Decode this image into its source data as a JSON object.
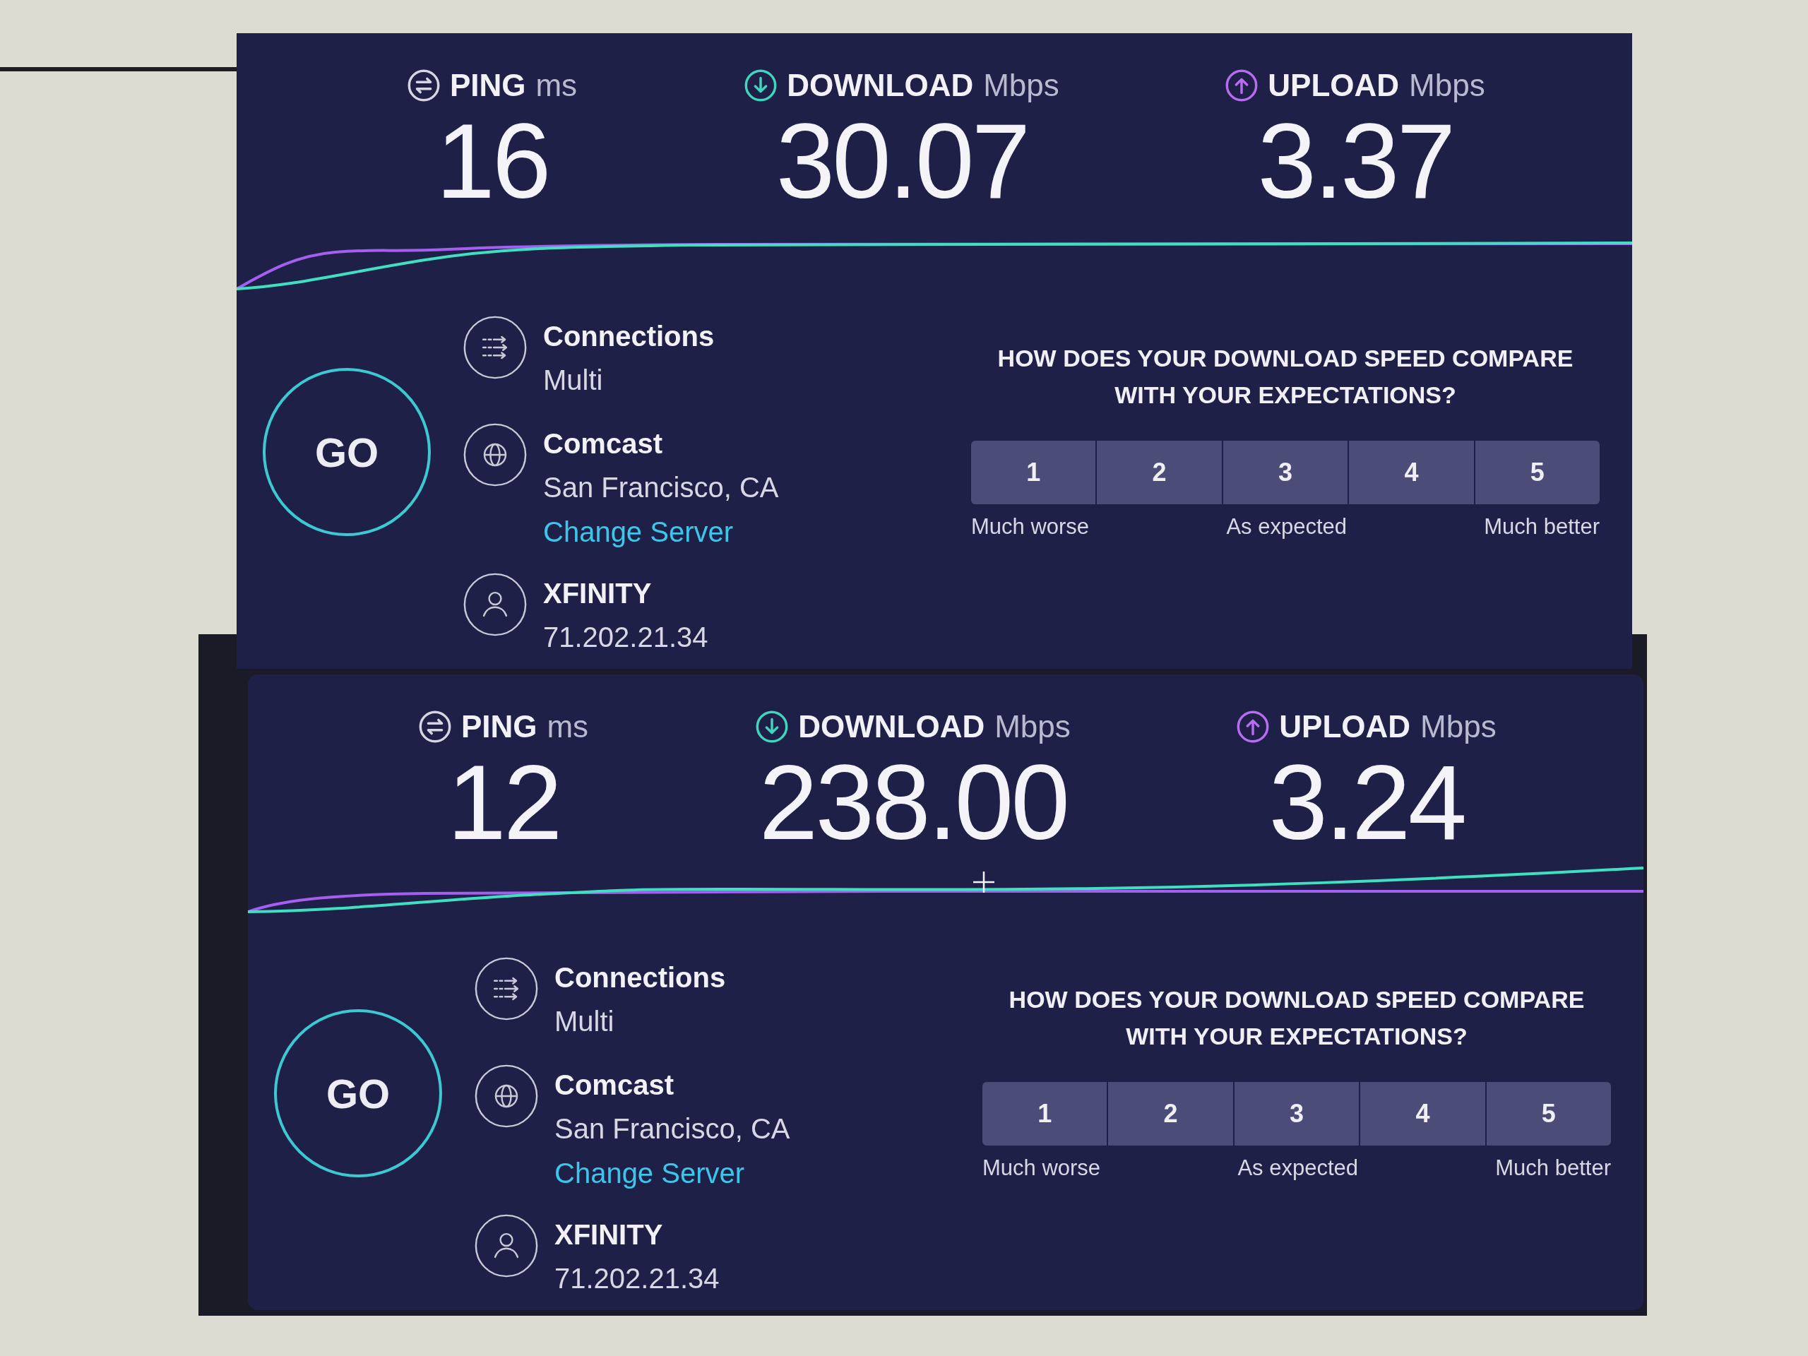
{
  "panels": [
    {
      "metrics": [
        {
          "kind": "ping",
          "label": "PING",
          "unit": "ms",
          "value": "16",
          "color": "#d6d6e0"
        },
        {
          "kind": "download",
          "label": "DOWNLOAD",
          "unit": "Mbps",
          "value": "30.07",
          "color": "#3fd6bf"
        },
        {
          "kind": "upload",
          "label": "UPLOAD",
          "unit": "Mbps",
          "value": "3.37",
          "color": "#b86cf0"
        }
      ],
      "cursor": false,
      "go_button": "GO",
      "details": [
        {
          "kind": "connections",
          "title": "Connections",
          "subtitle": "Multi"
        },
        {
          "kind": "server",
          "title": "Comcast",
          "subtitle": "San Francisco, CA",
          "link": "Change Server"
        },
        {
          "kind": "provider",
          "title": "XFINITY",
          "subtitle": "71.202.21.34"
        }
      ],
      "rating": {
        "question": "HOW DOES YOUR DOWNLOAD SPEED COMPARE WITH YOUR EXPECTATIONS?",
        "options": [
          {
            "label": "1",
            "selected": false
          },
          {
            "label": "2",
            "selected": false
          },
          {
            "label": "3",
            "selected": false
          },
          {
            "label": "4",
            "selected": false
          },
          {
            "label": "5",
            "selected": false
          }
        ],
        "scale_labels": [
          "Much worse",
          "As expected",
          "Much better"
        ]
      }
    },
    {
      "metrics": [
        {
          "kind": "ping",
          "label": "PING",
          "unit": "ms",
          "value": "12",
          "color": "#d6d6e0"
        },
        {
          "kind": "download",
          "label": "DOWNLOAD",
          "unit": "Mbps",
          "value": "238.00",
          "color": "#3fd6bf"
        },
        {
          "kind": "upload",
          "label": "UPLOAD",
          "unit": "Mbps",
          "value": "3.24",
          "color": "#b86cf0"
        }
      ],
      "cursor": true,
      "go_button": "GO",
      "details": [
        {
          "kind": "connections",
          "title": "Connections",
          "subtitle": "Multi"
        },
        {
          "kind": "server",
          "title": "Comcast",
          "subtitle": "San Francisco, CA",
          "link": "Change Server"
        },
        {
          "kind": "provider",
          "title": "XFINITY",
          "subtitle": "71.202.21.34"
        }
      ],
      "rating": {
        "question": "HOW DOES YOUR DOWNLOAD SPEED COMPARE WITH YOUR EXPECTATIONS?",
        "options": [
          {
            "label": "1",
            "selected": false
          },
          {
            "label": "2",
            "selected": false
          },
          {
            "label": "3",
            "selected": false
          },
          {
            "label": "4",
            "selected": false
          },
          {
            "label": "5",
            "selected": false
          }
        ],
        "scale_labels": [
          "Much worse",
          "As expected",
          "Much better"
        ]
      }
    }
  ]
}
